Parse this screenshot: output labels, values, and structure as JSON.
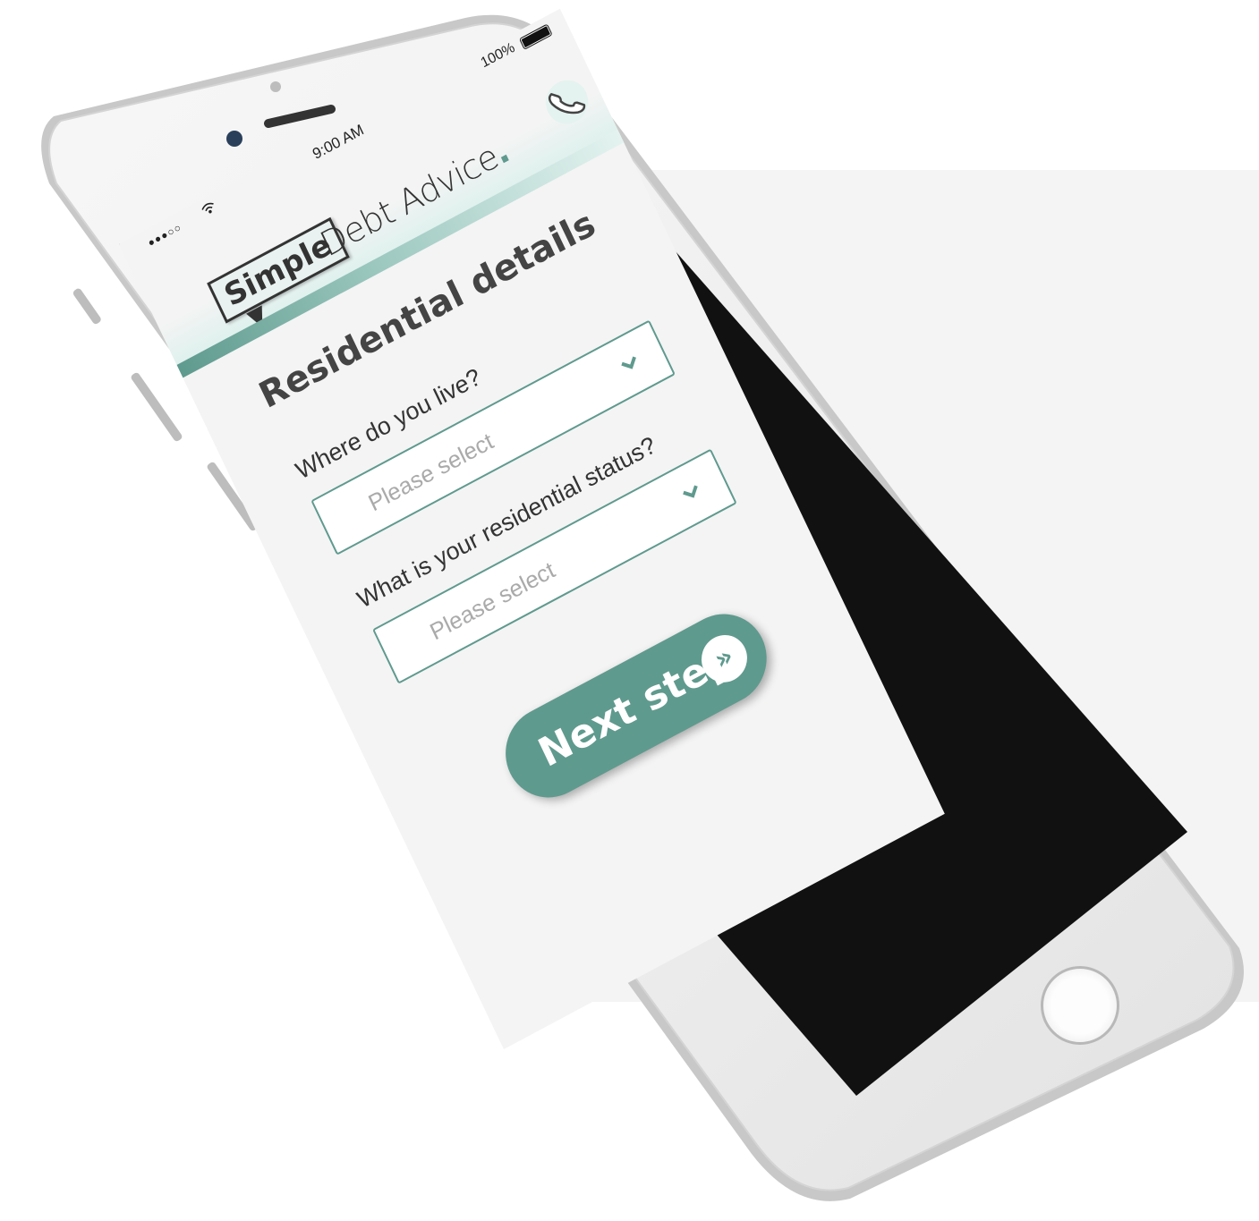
{
  "status_bar": {
    "signal": "●●●○○",
    "time": "9:00 AM",
    "battery": "100%"
  },
  "header": {
    "logo_primary": "Simple",
    "logo_secondary": "Debt Advice",
    "logo_dot": ".",
    "call_icon": "phone-icon"
  },
  "page": {
    "title": "Residential details"
  },
  "form": {
    "fields": [
      {
        "label": "Where do you live?",
        "placeholder": "Please select"
      },
      {
        "label": "What is your residential status?",
        "placeholder": "Please select"
      }
    ],
    "submit_label": "Next step",
    "submit_icon": "»"
  },
  "colors": {
    "accent": "#5f9a8e",
    "background": "#f4f4f4"
  }
}
